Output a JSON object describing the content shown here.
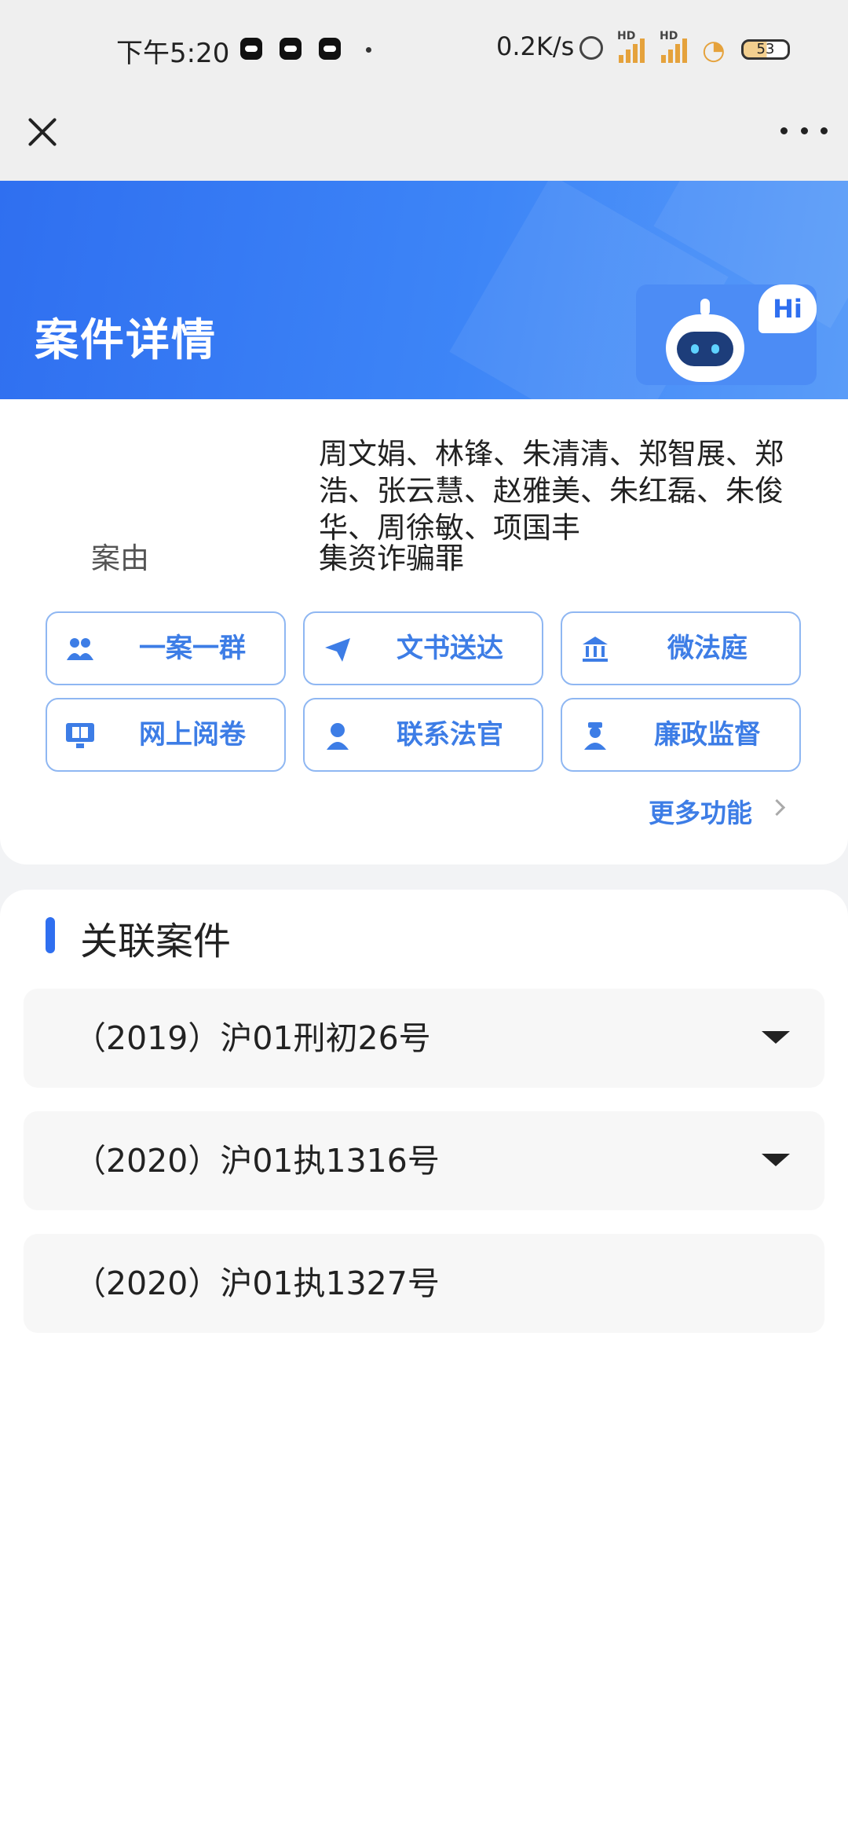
{
  "status_bar": {
    "time": "下午5:20",
    "net_speed": "0.2K/s",
    "signal_label": "HD",
    "battery": "53"
  },
  "header": {
    "title": "案件详情",
    "assistant_bubble": "Hi"
  },
  "case_info": {
    "parties_lines": [
      "周文娟、林锋、朱清清、郑智展、郑",
      "浩、张云慧、赵雅美、朱红磊、朱俊",
      "华、周徐敏、项国丰"
    ],
    "cause_label": "案由",
    "cause_value": "集资诈骗罪"
  },
  "functions": [
    {
      "label": "一案一群",
      "icon": "group-icon"
    },
    {
      "label": "文书送达",
      "icon": "paper-plane-icon"
    },
    {
      "label": "微法庭",
      "icon": "courthouse-icon"
    },
    {
      "label": "网上阅卷",
      "icon": "monitor-book-icon"
    },
    {
      "label": "联系法官",
      "icon": "judge-icon"
    },
    {
      "label": "廉政监督",
      "icon": "officer-icon"
    }
  ],
  "more_functions": "更多功能",
  "related": {
    "title": "关联案件",
    "cases": [
      {
        "number": "（2019）沪01刑初26号",
        "expandable": true
      },
      {
        "number": "（2020）沪01执1316号",
        "expandable": true
      },
      {
        "number": "（2020）沪01执1327号",
        "expandable": false
      }
    ]
  },
  "colors": {
    "accent": "#2f6ff0",
    "button_text": "#3d7de6",
    "button_border": "#8fb7f2"
  }
}
